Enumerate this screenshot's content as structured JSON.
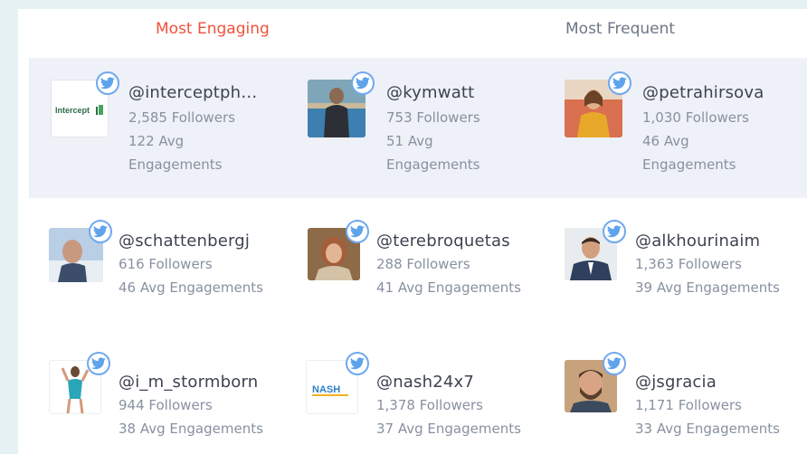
{
  "tabs": {
    "most_engaging": "Most Engaging",
    "most_frequent": "Most Frequent"
  },
  "colors": {
    "active_tab": "#f0523c",
    "inactive_tab": "#6d7687",
    "highlight_row": "#eef1f7",
    "twitter_badge": "#5ea3ec"
  },
  "accounts": [
    {
      "handle": "@interceptph…",
      "followers": "2,585 Followers",
      "engagement_line1": "122 Avg",
      "engagement_line2": "Engagements",
      "avatar_text": "Intercept",
      "icon": "twitter-icon"
    },
    {
      "handle": "@kymwatt",
      "followers": "753 Followers",
      "engagement_line1": "51 Avg",
      "engagement_line2": "Engagements",
      "icon": "twitter-icon"
    },
    {
      "handle": "@petrahirsova",
      "followers": "1,030 Followers",
      "engagement_line1": "46 Avg",
      "engagement_line2": "Engagements",
      "icon": "twitter-icon"
    },
    {
      "handle": "@schattenbergj",
      "followers": "616 Followers",
      "engagements": "46 Avg Engagements",
      "icon": "twitter-icon"
    },
    {
      "handle": "@terebroquetas",
      "followers": "288 Followers",
      "engagements": "41 Avg Engagements",
      "icon": "twitter-icon"
    },
    {
      "handle": "@alkhourinaim",
      "followers": "1,363 Followers",
      "engagements": "39 Avg Engagements",
      "icon": "twitter-icon"
    },
    {
      "handle": "@i_m_stormborn",
      "followers": "944 Followers",
      "engagements": "38 Avg Engagements",
      "icon": "twitter-icon"
    },
    {
      "handle": "@nash24x7",
      "followers": "1,378 Followers",
      "engagements": "37 Avg Engagements",
      "avatar_text": "NASH",
      "icon": "twitter-icon"
    },
    {
      "handle": "@jsgracia",
      "followers": "1,171 Followers",
      "engagements": "33 Avg Engagements",
      "icon": "twitter-icon"
    }
  ]
}
